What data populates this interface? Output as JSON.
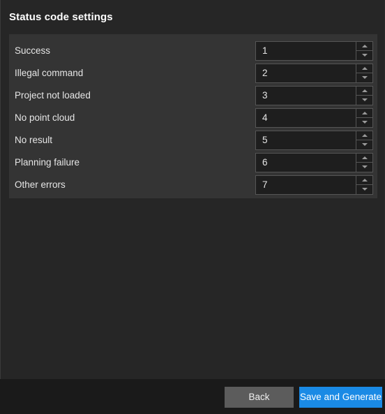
{
  "dialog": {
    "title": "Status code settings"
  },
  "settings": {
    "rows": [
      {
        "label": "Success",
        "value": "1"
      },
      {
        "label": "Illegal command",
        "value": "2"
      },
      {
        "label": "Project not loaded",
        "value": "3"
      },
      {
        "label": "No point cloud",
        "value": "4"
      },
      {
        "label": "No result",
        "value": "5"
      },
      {
        "label": "Planning failure",
        "value": "6"
      },
      {
        "label": "Other errors",
        "value": "7"
      }
    ],
    "spinner_up_icon": "triangle-up-icon",
    "spinner_down_icon": "triangle-down-icon"
  },
  "footer": {
    "back_label": "Back",
    "save_label": "Save and Generate"
  },
  "colors": {
    "window_background": "#262626",
    "card_background": "#343434",
    "footer_background": "#1a1a1a",
    "field_background": "#1e1e1e",
    "field_border": "#555555",
    "text": "#e6e6e6",
    "title_text": "#ffffff",
    "accent": "#1a8ae5",
    "secondary_button": "#5c5c5c"
  }
}
